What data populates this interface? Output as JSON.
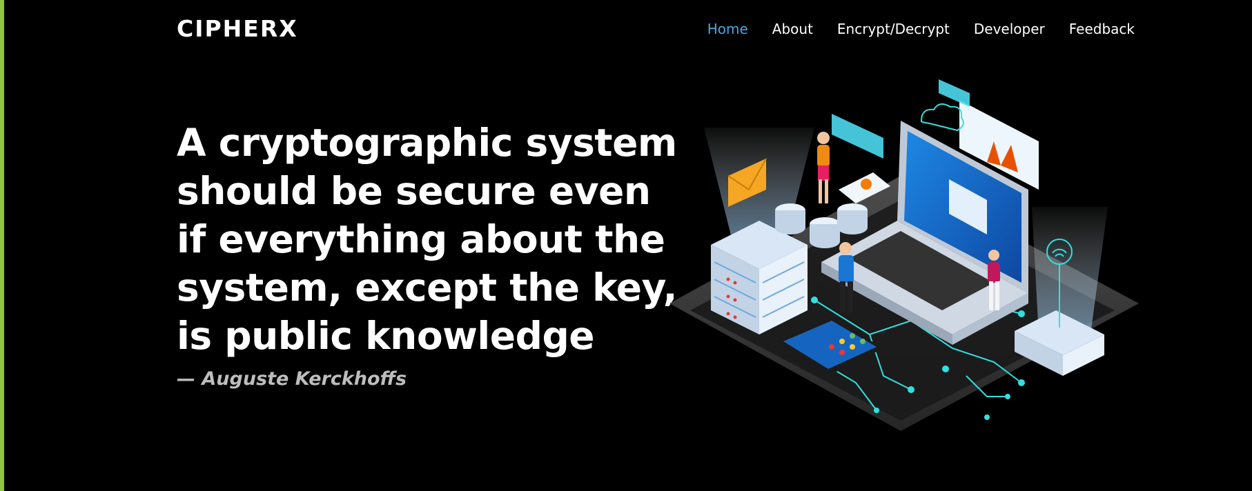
{
  "brand": {
    "logo_text": "CIPHERX"
  },
  "nav": {
    "items": [
      {
        "label": "Home",
        "active": true
      },
      {
        "label": "About",
        "active": false
      },
      {
        "label": "Encrypt/Decrypt",
        "active": false
      },
      {
        "label": "Developer",
        "active": false
      },
      {
        "label": "Feedback",
        "active": false
      }
    ]
  },
  "hero": {
    "quote_lines": [
      "A cryptographic system",
      "should be secure even",
      "if everything about the",
      "system, except the key,",
      "is public knowledge"
    ],
    "attribution": "— Auguste Kerckhoffs",
    "illustration": "isometric-cybersecurity-illustration"
  },
  "colors": {
    "background": "#000000",
    "accent_bar": "#8ec63f",
    "nav_active": "#4aa7e0",
    "text": "#ffffff",
    "attribution": "#bdbdbd"
  }
}
